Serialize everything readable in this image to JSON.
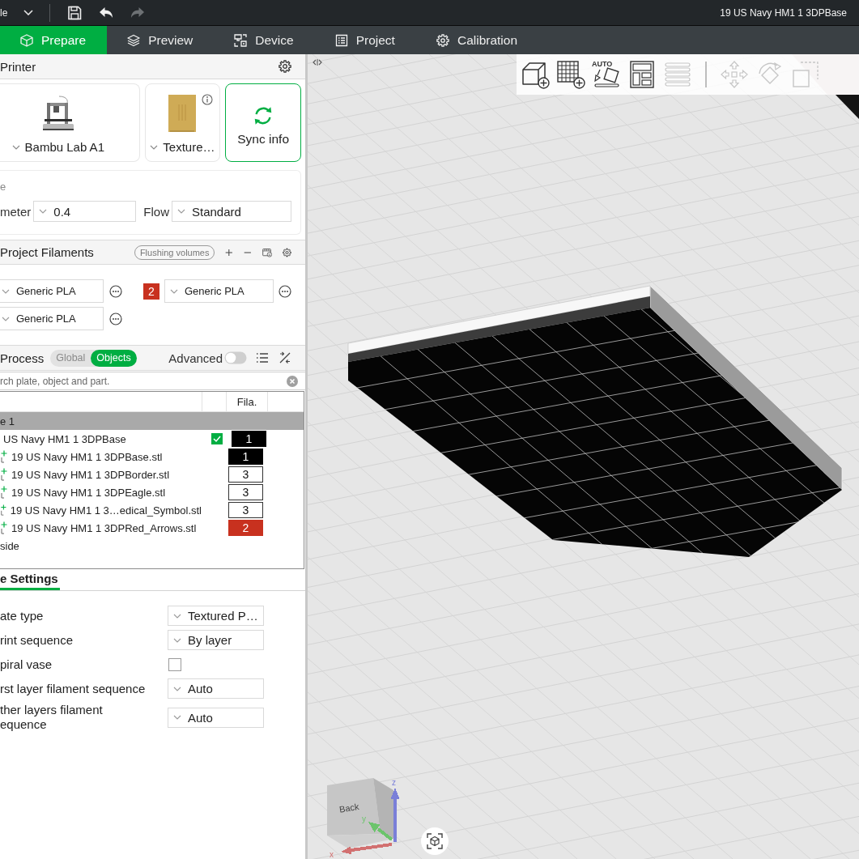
{
  "title_bar": {
    "menu": "le",
    "actions": [
      {
        "kind": "save",
        "disabled": false
      },
      {
        "kind": "undo",
        "disabled": false
      },
      {
        "kind": "redo",
        "disabled": true
      }
    ],
    "document_title": "19 US Navy HM1 1 3DPBase"
  },
  "tabs": [
    {
      "label": "Prepare",
      "selected": true
    },
    {
      "label": "Preview",
      "selected": false
    },
    {
      "label": "Device",
      "selected": false
    },
    {
      "label": "Project",
      "selected": false
    },
    {
      "label": "Calibration",
      "selected": false
    }
  ],
  "printer": {
    "title": "Printer",
    "printer_name": "Bambu Lab A1",
    "plate_type": "Texture…",
    "sync_button": "Sync info",
    "nozzle_title": "e",
    "diameter_label": "meter",
    "diameter": "0.4",
    "flow_label": "Flow",
    "flow": "Standard"
  },
  "filaments": {
    "title": "Project Filaments",
    "flushing_button": "Flushing volumes",
    "items": [
      {
        "value": "Generic PLA"
      },
      {
        "number": "2",
        "color": "#c8311f",
        "value": "Generic PLA"
      },
      {
        "value": "Generic PLA"
      }
    ]
  },
  "process": {
    "title": "Process",
    "modes": [
      {
        "label": "Global",
        "selected": false
      },
      {
        "label": "Objects",
        "selected": true
      }
    ],
    "advanced_label": "Advanced",
    "advanced_on": false
  },
  "object_list": {
    "search_placeholder": "rch plate, object and part.",
    "filament_column": "Fila.",
    "rows": [
      {
        "kind": "plate",
        "label": "e 1",
        "selected": true,
        "children": [
          {
            "kind": "object",
            "label": "US Navy HM1 1 3DPBase",
            "checked": true,
            "filament": "1",
            "color": "#000000",
            "children": [
              {
                "kind": "part",
                "label": "19 US Navy HM1 1 3DPBase.stl",
                "filament": "1",
                "color": "#000000"
              },
              {
                "kind": "part",
                "label": "19 US Navy HM1 1 3DPBorder.stl",
                "filament": "3",
                "color": "#ffffff"
              },
              {
                "kind": "part",
                "label": "19 US Navy HM1 1 3DPEagle.stl",
                "filament": "3",
                "color": "#ffffff"
              },
              {
                "kind": "part",
                "label": "19 US Navy HM1 1 3…edical_Symbol.stl",
                "filament": "3",
                "color": "#ffffff"
              },
              {
                "kind": "part",
                "label": "19 US Navy HM1 1 3DPRed_Arrows.stl",
                "filament": "2",
                "color": "#c8311f"
              }
            ]
          }
        ]
      },
      {
        "kind": "plate",
        "label": "side",
        "selected": false
      }
    ]
  },
  "plate_settings": {
    "tab": {
      "label": "e Settings",
      "selected": true
    },
    "rows": [
      {
        "kind": "select",
        "label": "ate type",
        "value": "Textured P…"
      },
      {
        "kind": "select",
        "label": "rint sequence",
        "value": "By layer"
      },
      {
        "kind": "checkbox",
        "label": "piral vase",
        "checked": false
      },
      {
        "kind": "select",
        "label": "rst layer filament sequence",
        "value": "Auto"
      },
      {
        "kind": "select",
        "label": "ther layers filament\nequence",
        "value": "Auto"
      }
    ]
  },
  "viewport": {
    "toolbar": [
      {
        "kind": "add-object",
        "disabled": false
      },
      {
        "kind": "add-plate",
        "disabled": false
      },
      {
        "kind": "auto-orient",
        "label": "AUTO",
        "disabled": false
      },
      {
        "kind": "arrange",
        "disabled": false
      },
      {
        "kind": "layers",
        "disabled": true
      },
      {
        "kind": "separator"
      },
      {
        "kind": "move",
        "disabled": true
      },
      {
        "kind": "rotate",
        "disabled": true
      },
      {
        "kind": "scale",
        "disabled": true
      }
    ],
    "view_cube": {
      "face": "Back",
      "axes": [
        {
          "label": "z",
          "color": "#7a7fd8"
        },
        {
          "label": "y",
          "color": "#6cc46c"
        },
        {
          "label": "x",
          "color": "#d27070"
        }
      ]
    }
  }
}
